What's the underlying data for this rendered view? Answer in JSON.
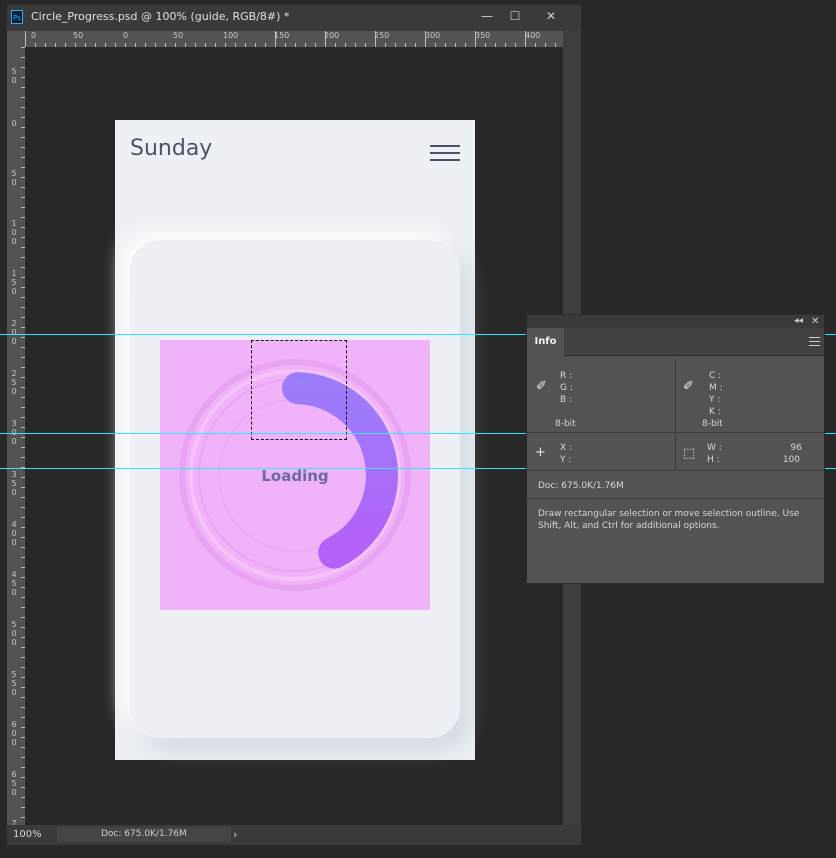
{
  "document": {
    "title": "Circle_Progress.psd @ 100% (guide, RGB/8#) *",
    "app_icon": "Ps",
    "controls": {
      "minimize": "—",
      "maximize": "☐",
      "close": "✕"
    },
    "ruler_top_labels": [
      "0",
      "50",
      "0",
      "50",
      "100",
      "150",
      "200",
      "250",
      "300",
      "350",
      "400"
    ],
    "ruler_left_labels": [
      "5\n0",
      "0",
      "5\n0",
      "1\n0\n0",
      "1\n5\n0",
      "2\n0\n0",
      "2\n5\n0",
      "3\n0\n0",
      "3\n5\n0",
      "4\n0\n0",
      "4\n5\n0",
      "5\n0\n0",
      "5\n5\n0",
      "6\n0\n0",
      "6\n5\n0",
      "7"
    ],
    "status": {
      "zoom": "100%",
      "doc": "Doc: 675.0K/1.76M",
      "arrow": "›"
    }
  },
  "artboard": {
    "app_title": "Sunday",
    "loading_label": "Loading",
    "progress": 0.42,
    "colors": {
      "background": "#edf1f5",
      "selection": "#f0b2f8",
      "arc_start": "#9b7dfb",
      "arc_end": "#b461f6",
      "text": "#4a5368"
    }
  },
  "info_panel": {
    "tab": "Info",
    "collapse": "◂◂",
    "close": "✕",
    "rgb": {
      "r": "R :",
      "g": "G :",
      "b": "B :",
      "bit": "8-bit"
    },
    "cmyk": {
      "c": "C :",
      "m": "M :",
      "y": "Y :",
      "k": "K :",
      "bit": "8-bit"
    },
    "xy": {
      "x": "X :",
      "y": "Y :"
    },
    "wh": {
      "w": "W :",
      "w_value": "96",
      "h": "H :",
      "h_value": "100"
    },
    "doc": "Doc: 675.0K/1.76M",
    "help": "Draw rectangular selection or move selection outline.  Use Shift, Alt, and Ctrl for additional options."
  }
}
